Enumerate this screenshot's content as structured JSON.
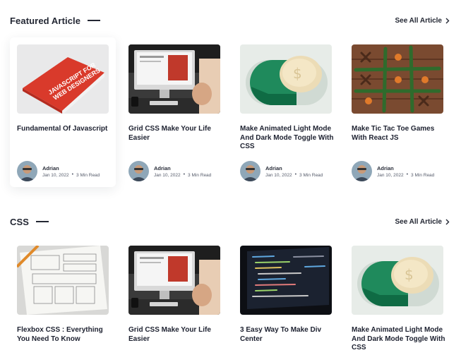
{
  "sections": [
    {
      "title": "Featured Article",
      "see_all": "See All Article",
      "cards": [
        {
          "title": "Fundamental Of Javascript",
          "author": "Adrian",
          "date": "Jan 10, 2022",
          "read": "3 Min Read",
          "thumb": "javascript-book"
        },
        {
          "title": "Grid CSS Make Your Life Easier",
          "author": "Adrian",
          "date": "Jan 10, 2022",
          "read": "3 Min Read",
          "thumb": "imac-desk"
        },
        {
          "title": "Make Animated Light Mode And Dark Mode Toggle With CSS",
          "author": "Adrian",
          "date": "Jan 10, 2022",
          "read": "3 Min Read",
          "thumb": "toggle-switch"
        },
        {
          "title": "Make Tic Tac Toe Games With React JS",
          "author": "Adrian",
          "date": "Jan 10, 2022",
          "read": "3 Min Read",
          "thumb": "tic-tac-toe"
        }
      ]
    },
    {
      "title": "CSS",
      "see_all": "See All Article",
      "cards": [
        {
          "title": "Flexbox CSS : Everything You Need To Know",
          "thumb": "wireframe-sketch"
        },
        {
          "title": "Grid CSS Make Your Life Easier",
          "thumb": "imac-desk"
        },
        {
          "title": "3 Easy Way To Make Div Center",
          "thumb": "code-laptop"
        },
        {
          "title": "Make Animated Light Mode And Dark Mode Toggle With CSS",
          "thumb": "toggle-switch"
        }
      ]
    }
  ],
  "colors": {
    "text": "#232733",
    "book_red": "#d93a2b",
    "toggle_green": "#1f8a5c",
    "wood": "#7a4a30"
  }
}
